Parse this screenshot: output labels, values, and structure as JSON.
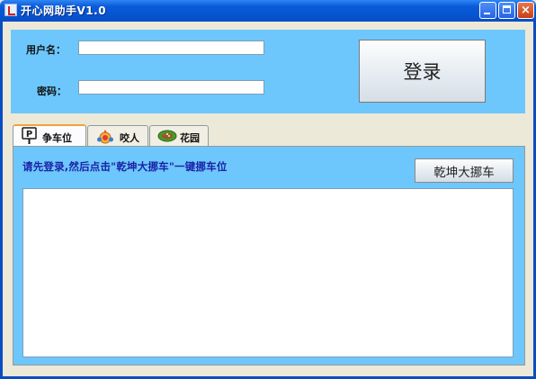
{
  "window": {
    "title": "开心网助手V1.0",
    "controls": {
      "minimize": "minimize",
      "maximize": "maximize",
      "close": "×"
    }
  },
  "login": {
    "username_label": "用户名：",
    "username_value": "",
    "password_label": "密码：",
    "password_value": "",
    "login_button": "登录"
  },
  "tabs": [
    {
      "label": "争车位",
      "icon": "parking-icon",
      "active": true
    },
    {
      "label": "咬人",
      "icon": "face-icon",
      "active": false
    },
    {
      "label": "花园",
      "icon": "garden-icon",
      "active": false
    }
  ],
  "content": {
    "hint": "请先登录,然后点击\"乾坤大挪车\"一键挪车位",
    "move_button": "乾坤大挪车",
    "log_text": ""
  },
  "colors": {
    "panel_bg": "#6dc7fc",
    "titlebar": "#0554d1",
    "hint_text": "#1a22a8",
    "active_tab_accent": "#f1a33b"
  }
}
